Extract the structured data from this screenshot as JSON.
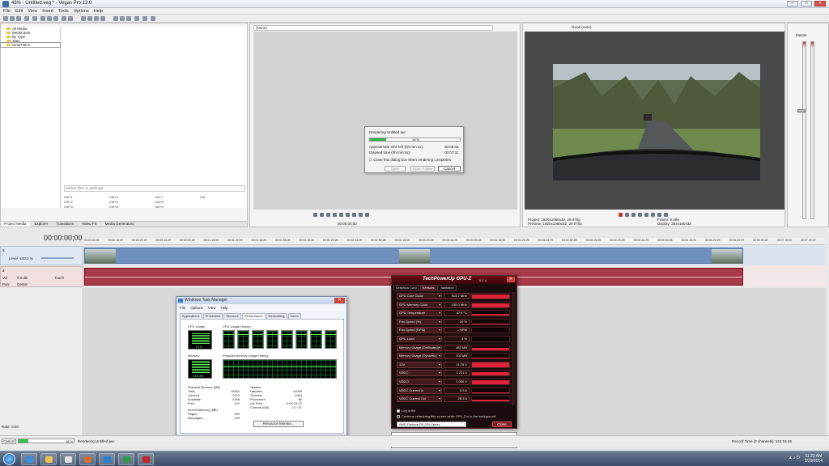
{
  "window": {
    "title": "46% - Untitled.veg * - Vegas Pro 13.0",
    "controls": [
      "—",
      "□",
      "✕"
    ]
  },
  "menu": [
    "File",
    "Edit",
    "View",
    "Insert",
    "Tools",
    "Options",
    "Help"
  ],
  "explorer": {
    "tree": [
      "All Media",
      "Media Bins",
      "By Type",
      "Tags",
      "Smart Bins"
    ],
    "effect_search_placeholder": "Select filter to add tags",
    "shortcuts": [
      "Ctrl+1",
      "Ctrl+4",
      "Ctrl+7",
      "Ctrl",
      "Ctrl+2",
      "Ctrl+5",
      "Ctrl+8",
      "",
      "Ctrl+3",
      "Ctrl+6",
      "Ctrl+9",
      ""
    ],
    "tabs": [
      "Project Media",
      "Explorer",
      "Transitions",
      "Video FX",
      "Media Generators"
    ]
  },
  "trimmer": {
    "source": "(None)",
    "timecode_start": "00:00:00;00"
  },
  "preview": {
    "quality": "Good (Auto)",
    "project": "Project:  1920x1080x32, 29.970p",
    "preview_res": "Preview:  1920x1080x32, 29.970p",
    "frame": "Frame:  8,395",
    "display": "Display:  284x160x32"
  },
  "master": {
    "label": "Master"
  },
  "timeline": {
    "timecode": "00:00:00;00",
    "ruler": [
      "00:00:00;00",
      "00:00:15;00",
      "00:00:29;29",
      "00:00:44;29",
      "00:00:59;28",
      "00:01:15;00",
      "00:01:29;29",
      "00:01:44;29",
      "00:01:59;28",
      "00:02:15;00",
      "00:02:29;29",
      "00:02:44;29",
      "00:02:59;28",
      "00:03:15;00",
      "00:03:29;29",
      "00:03:44;29",
      "00:03:59;28",
      "00:04:15;00",
      "00:04:29;29",
      "00:04:44;29",
      "00:04:59;28",
      "00:05:15;00",
      "00:05:29;29",
      "00:05:44;29",
      "00:05:59;28",
      "00:06:15;00",
      "00:06:29;29",
      "00:06:44;29",
      "00:06:59;28",
      "00:07:15;00",
      "00:07:29;29"
    ],
    "video_track": {
      "number": "1",
      "level": "Level: 100.0 %"
    },
    "audio_track": {
      "number": "2",
      "vol": "Vol:",
      "vol_value": "0.0 dB",
      "pan": "Pan:",
      "pan_value": "Center",
      "mode": "Touch"
    }
  },
  "status": {
    "rate": "Rate: 0.00",
    "cancel": "Cancel",
    "render_percent": "18 %",
    "render_progress": 0.18,
    "render_label": "Rendering Untitled.avc",
    "record_time": "Record Time (2 channels): 104:04:46"
  },
  "render_dialog": {
    "title": "Rendering Untitled.avc",
    "percent": "18 %",
    "progress": 0.18,
    "approx_label": "Approximate time left (hh:mm:ss):",
    "approx_value": "00:08:05",
    "elapsed_label": "Elapsed time (hh:mm:ss):",
    "elapsed_value": "00:07:31",
    "close_check": "Close this dialog box when rendering completes",
    "open": "Open",
    "open_folder": "Open Folder",
    "cancel": "Cancel"
  },
  "taskmgr": {
    "title": "Windows Task Manager",
    "close": "✕",
    "menu": [
      "File",
      "Options",
      "View",
      "Help"
    ],
    "tabs": [
      "Applications",
      "Processes",
      "Services",
      "Performance",
      "Networking",
      "Users"
    ],
    "cpu_usage_label": "CPU Usage",
    "cpu_usage_value": "75 %",
    "cpu_usage_fraction": 0.75,
    "cpu_history_label": "CPU Usage History",
    "memory_label": "Memory",
    "memory_value": "13.8 GB",
    "memory_fraction": 0.88,
    "memory_history_label": "Physical Memory Usage History",
    "physical_title": "Physical Memory (MB)",
    "physical": [
      [
        "Total",
        "16362"
      ],
      [
        "Cached",
        "2222"
      ],
      [
        "Available",
        "2268"
      ],
      [
        "Free",
        "121"
      ]
    ],
    "kernel_title": "Kernel Memory (MB)",
    "kernel": [
      [
        "Paged",
        "269"
      ],
      [
        "Nonpaged",
        "109"
      ]
    ],
    "system_title": "System",
    "system": [
      [
        "Handles",
        "41095"
      ],
      [
        "Threads",
        "1064"
      ],
      [
        "Processes",
        "66"
      ],
      [
        "Up Time",
        "0:00:24:27"
      ],
      [
        "Commit (GB)",
        "17 / 31"
      ]
    ],
    "resource_monitor": "Resource Monitor...",
    "status_processes": "Processes: 66",
    "status_cpu": "CPU Usage: 75%",
    "status_memory": "Physical Memory: 86%"
  },
  "gpuz": {
    "title": "TechPowerUp GPU-Z",
    "version": "0.7.4",
    "close": "✕",
    "tabs": [
      "Graphics Card",
      "Sensors",
      "Validation"
    ],
    "sensors": [
      {
        "name": "GPU Core Clock",
        "value": "914.7 MHz",
        "level": 0.8
      },
      {
        "name": "GPU Memory Clock",
        "value": "150.0 MHz",
        "level": 0.7
      },
      {
        "name": "GPU Temperature",
        "value": "37.0 °C",
        "level": 0.3
      },
      {
        "name": "Fan Speed (%)",
        "value": "20 %",
        "level": 0.2
      },
      {
        "name": "Fan Speed (RPM)",
        "value": "-- RPM",
        "level": 0.0
      },
      {
        "name": "GPU Load",
        "value": "4 %",
        "level": 0.05
      },
      {
        "name": "Memory Usage (Dedicated)",
        "value": "482 MB",
        "level": 0.35
      },
      {
        "name": "Memory Usage (Dynamic)",
        "value": "102 MB",
        "level": 0.15
      },
      {
        "name": "12V",
        "value": "11.75 V",
        "level": 0.9
      },
      {
        "name": "VDDC",
        "value": "1.211 V",
        "level": 0.75
      },
      {
        "name": "VDDCI",
        "value": "1.000 V",
        "level": 0.85
      },
      {
        "name": "VDDC Current In",
        "value": "3.3 A",
        "level": 0.1
      },
      {
        "name": "VDDC Current Out",
        "value": "28.5 A",
        "level": 0.4
      }
    ],
    "log_to_file": "Log to file",
    "continue_refresh": "Continue refreshing this screen while GPU-Z is in the background",
    "device": "AMD Radeon R9 200 Series",
    "close_button": "Close"
  },
  "notify": {
    "message": "New version available: GPU-Z 0.7.7",
    "button": "Update Now"
  },
  "taskbar": {
    "time": "11:23 AM",
    "date": "3/29/2014"
  }
}
